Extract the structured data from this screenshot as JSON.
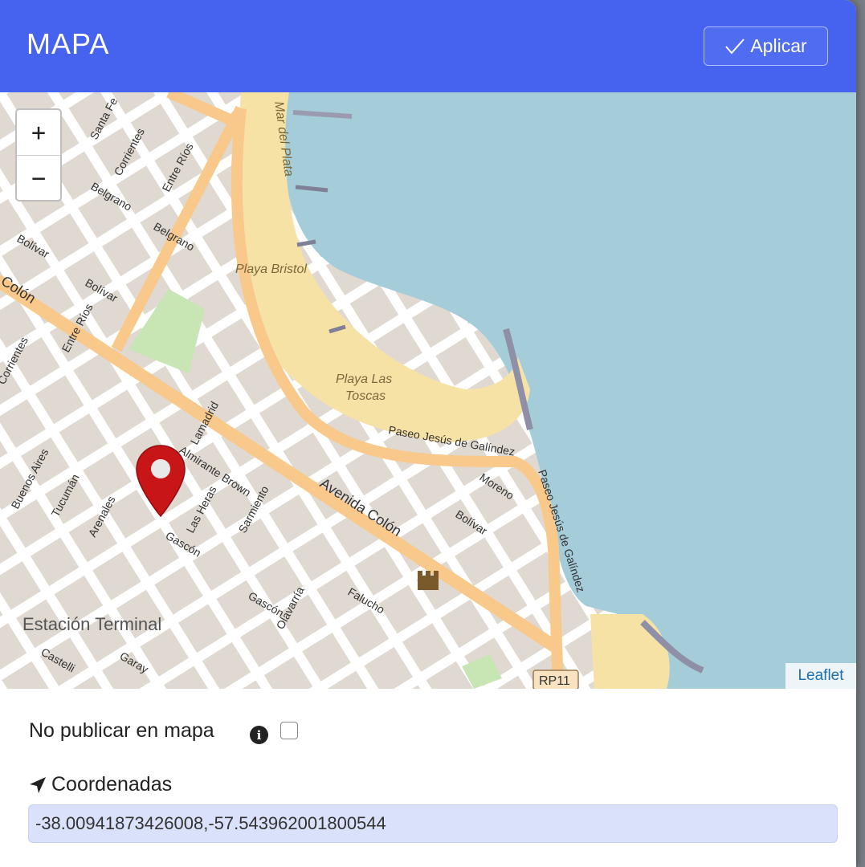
{
  "dialog": {
    "title": "MAPA",
    "apply_label": "Aplicar"
  },
  "map": {
    "zoom_in": "+",
    "zoom_out": "−",
    "attribution": "Leaflet",
    "labels": {
      "mar_del_plata": "Mar del Plata",
      "playa_bristol": "Playa Bristol",
      "playa_las_toscas_1": "Playa Las",
      "playa_las_toscas_2": "Toscas",
      "paseo_jesus": "Paseo Jesús de Galíndez",
      "paseo_jesus_2": "Paseo Jesús de Galíndez",
      "avenida_colon": "Avenida Colón",
      "colon": "Colón",
      "estacion_terminal": "Estación Terminal",
      "rp11": "RP11",
      "santa_fe": "Santa Fe",
      "corrientes": "Corrientes",
      "corrientes_2": "Corrientes",
      "entre_rios": "Entre Ríos",
      "entre_rios_2": "Entre Ríos",
      "belgrano": "Belgrano",
      "belgrano_2": "Belgrano",
      "bolivar": "Bolívar",
      "bolivar_2": "Bolívar",
      "bolivar_3": "Bolívar",
      "buenos_aires": "Buenos Aires",
      "tucuman": "Tucumán",
      "arenales": "Arenales",
      "lamadrid": "Lamadrid",
      "almirante_brown": "Almirante Brown",
      "las_heras": "Las Heras",
      "sarmiento": "Sarmiento",
      "gascon": "Gascón",
      "gascon_2": "Gascón",
      "olavarria": "Olavarría",
      "falucho": "Falucho",
      "moreno": "Moreno",
      "garay": "Garay",
      "castelli": "Castelli"
    },
    "colors": {
      "sea": "#a5cdd9",
      "beach": "#f7e2a6",
      "land": "#f2efe9",
      "block": "#dfd9d1",
      "road": "#f8c98b",
      "park": "#c8e5b4",
      "marker": "#c81618"
    }
  },
  "form": {
    "no_publicar_label": "No publicar en mapa",
    "info_icon": "info-icon",
    "no_publicar_checked": false,
    "coords_label": "Coordenadas",
    "coords_value": "-38.00941873426008,-57.543962001800544"
  }
}
